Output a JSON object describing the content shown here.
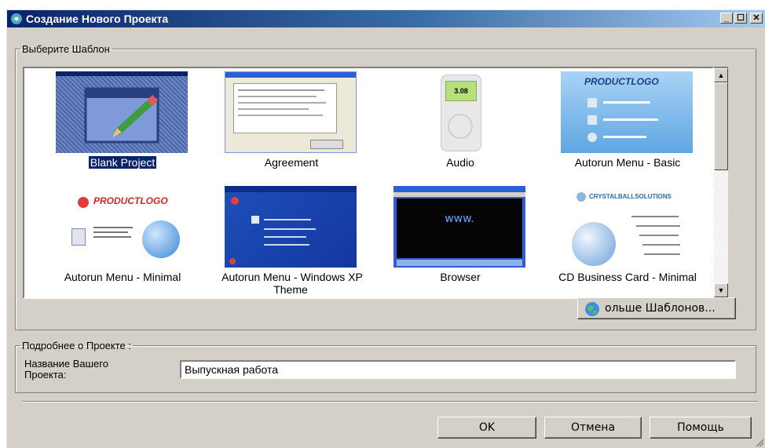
{
  "window": {
    "title": "Создание Нового Проекта",
    "controls": {
      "minimize": "_",
      "maximize": "☐",
      "close": "✕"
    }
  },
  "templates_group": {
    "legend": "Выберите Шаблон",
    "items": [
      {
        "label": "Blank Project",
        "selected": true
      },
      {
        "label": "Agreement"
      },
      {
        "label": "Audio",
        "screen_value": "3.08"
      },
      {
        "label": "Autorun Menu - Basic",
        "logo": "PRODUCTLOGO"
      },
      {
        "label": "Autorun Menu - Minimal",
        "logo": "PRODUCTLOGO"
      },
      {
        "label": "Autorun Menu - Windows XP Theme"
      },
      {
        "label": "Browser",
        "screen_text": "www."
      },
      {
        "label": "CD Business Card - Minimal",
        "logo": "CRYSTALBALLSOLUTIONS"
      }
    ],
    "more_button": "ольше Шаблонов..."
  },
  "details_group": {
    "legend": "Подробнее о Проекте :",
    "name_label": "Название Вашего Проекта:",
    "name_value": "Выпускная работа"
  },
  "footer": {
    "ok": "OK",
    "cancel": "Отмена",
    "help": "Помощь"
  },
  "colors": {
    "title_start": "#0a246a",
    "title_end": "#a6caf0",
    "face": "#d4d0c8",
    "selection": "#0a246a"
  }
}
